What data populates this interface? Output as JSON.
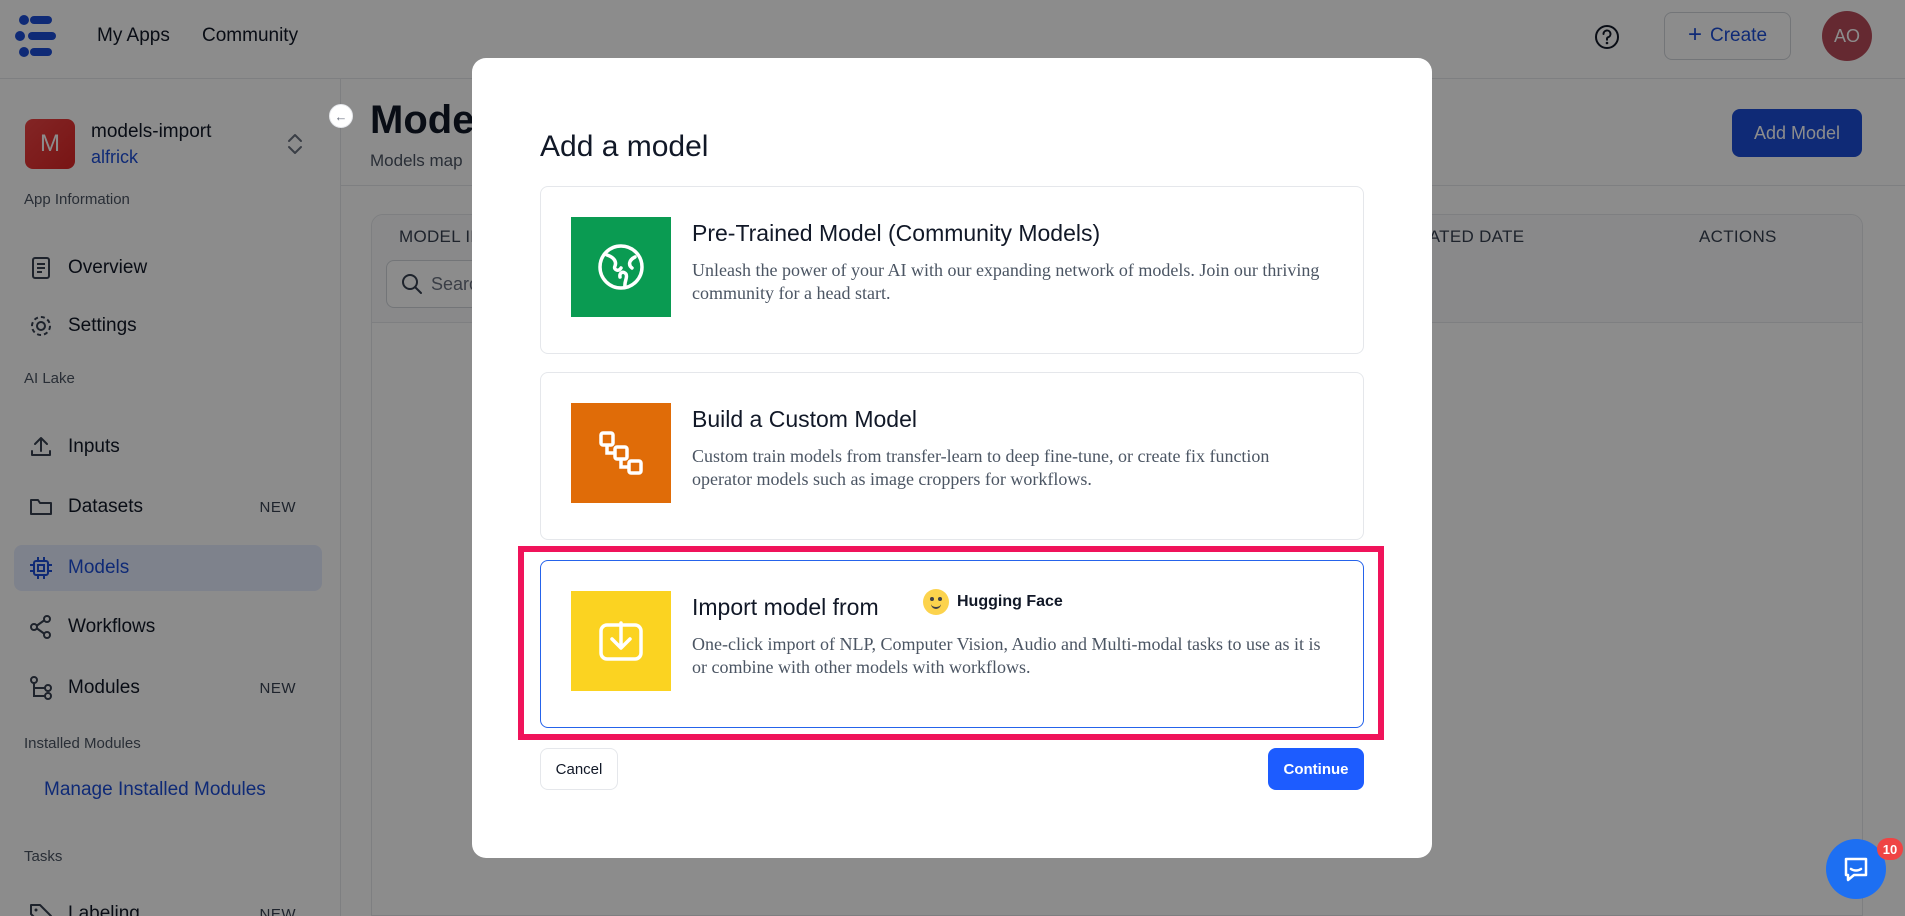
{
  "header": {
    "nav": [
      "My Apps",
      "Community"
    ],
    "create_label": "Create",
    "avatar_initials": "AO"
  },
  "sidebar": {
    "app": {
      "initial": "M",
      "name": "models-import",
      "owner": "alfrick"
    },
    "sections": {
      "app_info": "App Information",
      "ai_lake": "AI Lake",
      "installed_modules": "Installed Modules",
      "tasks": "Tasks"
    },
    "items": {
      "overview": "Overview",
      "settings": "Settings",
      "inputs": "Inputs",
      "datasets": "Datasets",
      "models": "Models",
      "workflows": "Workflows",
      "modules": "Modules",
      "labeling": "Labeling"
    },
    "badges": {
      "datasets": "NEW",
      "modules": "NEW",
      "labeling": "NEW"
    },
    "manage_link": "Manage Installed Modules"
  },
  "main": {
    "title": "Models",
    "subtitle": "Models map",
    "add_button": "Add Model",
    "columns": {
      "model_id": "MODEL ID",
      "date": "CREATED DATE",
      "actions": "ACTIONS"
    },
    "search_placeholder": "Search"
  },
  "modal": {
    "title": "Add a model",
    "options": [
      {
        "title": "Pre-Trained Model (Community Models)",
        "description": "Unleash the power of your AI with our expanding network of models. Join our thriving community for a head start.",
        "color": "#0a9b52"
      },
      {
        "title": "Build a Custom Model",
        "description": "Custom train models from transfer-learn to deep fine-tune, or create fix function operator models such as image croppers for workflows.",
        "color": "#e06c08"
      },
      {
        "title": "Import model from",
        "brand": "Hugging Face",
        "description": "One-click import of NLP, Computer Vision, Audio and Multi-modal tasks to use as it is or combine with other models with workflows.",
        "color": "#fbd321"
      }
    ],
    "cancel_label": "Cancel",
    "continue_label": "Continue"
  },
  "chat": {
    "badge_count": "10"
  }
}
